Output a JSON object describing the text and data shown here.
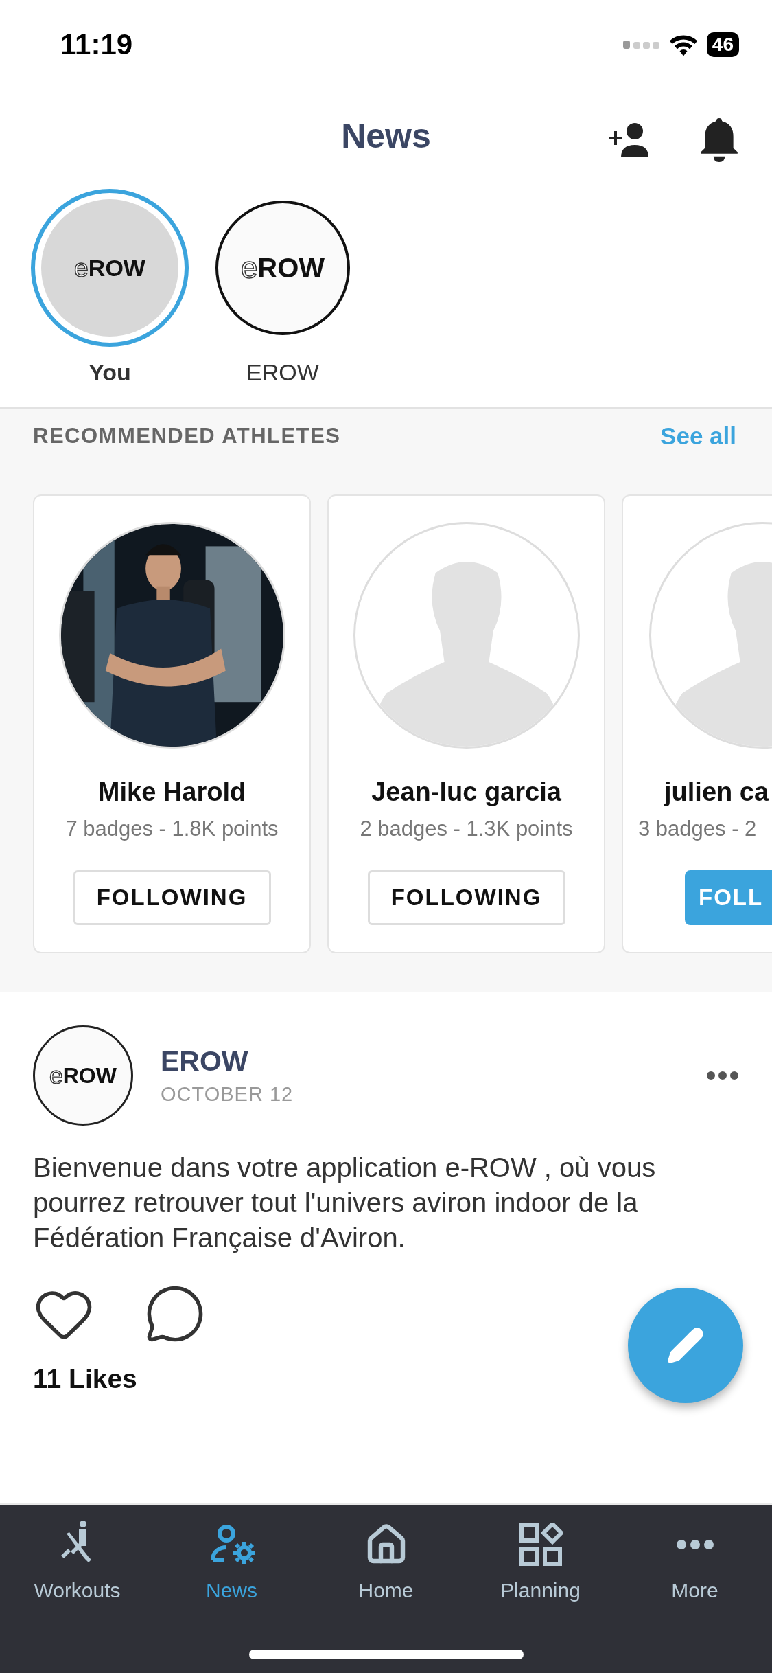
{
  "status_bar": {
    "time": "11:19",
    "battery": "46"
  },
  "header": {
    "title": "News"
  },
  "stories": [
    {
      "label": "You",
      "logo_e": "e",
      "logo_word": "ROW",
      "selected": true
    },
    {
      "label": "EROW",
      "logo_e": "e",
      "logo_word": "ROW",
      "selected": false
    }
  ],
  "recommended": {
    "title": "RECOMMENDED ATHLETES",
    "see_all": "See all",
    "athletes": [
      {
        "name": "Mike Harold",
        "stats": "7 badges - 1.8K points",
        "button": "FOLLOWING",
        "following": true,
        "kind": "picture"
      },
      {
        "name": "Jean-luc garcia",
        "stats": "2 badges - 1.3K points",
        "button": "FOLLOWING",
        "following": true,
        "kind": "silhouette"
      },
      {
        "name": "julien ca",
        "stats": "3 badges - 2",
        "button": "FOLL",
        "following": false,
        "kind": "silhouette"
      }
    ]
  },
  "post": {
    "author": "EROW",
    "logo_e": "e",
    "logo_word": "ROW",
    "date": "OCTOBER 12",
    "text": "Bienvenue dans votre application e-ROW , où vous pourrez retrouver tout l'univers aviron indoor de la Fédération Française d'Aviron.",
    "likes": "11 Likes"
  },
  "tab_bar": [
    {
      "label": "Workouts",
      "kind": "rower",
      "selected": false
    },
    {
      "label": "News",
      "kind": "usercog",
      "selected": true
    },
    {
      "label": "Home",
      "kind": "home",
      "selected": false
    },
    {
      "label": "Planning",
      "kind": "grid",
      "selected": false
    },
    {
      "label": "More",
      "kind": "more",
      "selected": false
    }
  ]
}
